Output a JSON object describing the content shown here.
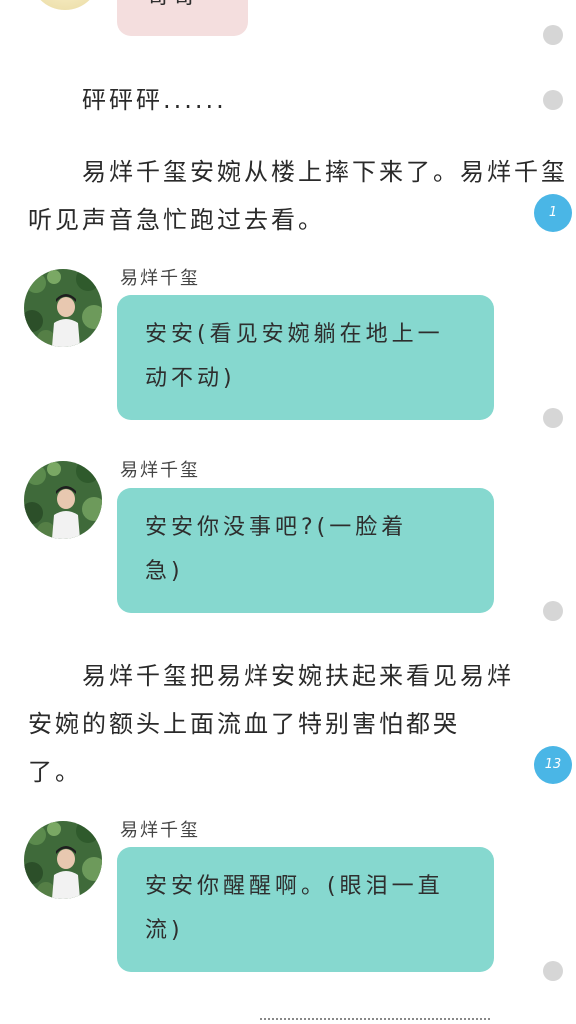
{
  "theme": {
    "bubble_teal": "#86d8cf",
    "bubble_pink": "#f4dede",
    "badge_blue": "#4ab6e6",
    "dot_grey": "#d6d6d6"
  },
  "top_partial": {
    "bubble_text": "哥哥~"
  },
  "narrations": [
    {
      "lines": [
        "砰砰砰......"
      ]
    },
    {
      "lines": [
        "易烊千玺安婉从楼上摔下来了。易烊千玺",
        "听见声音急忙跑过去看。"
      ]
    },
    {
      "lines": [
        "易烊千玺把易烊安婉扶起来看见易烊",
        "安婉的额头上面流血了特别害怕都哭",
        "了。"
      ]
    }
  ],
  "messages": [
    {
      "speaker": "易烊千玺",
      "lines": [
        "安安(看见安婉躺在地上一",
        "动不动)"
      ]
    },
    {
      "speaker": "易烊千玺",
      "lines": [
        "安安你没事吧?(一脸着",
        "急)"
      ]
    },
    {
      "speaker": "易烊千玺",
      "lines": [
        "安安你醒醒啊。(眼泪一直",
        "流)"
      ]
    }
  ],
  "comment_badges": [
    {
      "count": "1"
    },
    {
      "count": "13"
    }
  ],
  "icons": {
    "avatar": "boy-portrait-avatar",
    "side_marker": "paragraph-comment-dot"
  }
}
